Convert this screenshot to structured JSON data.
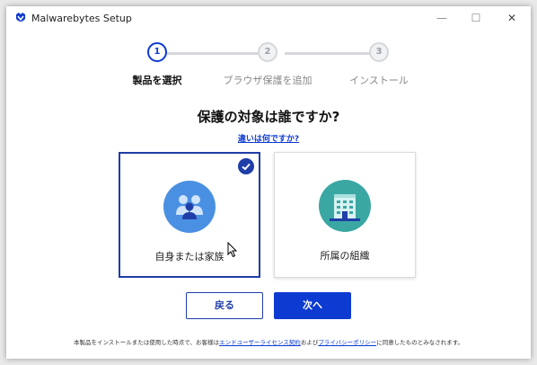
{
  "window": {
    "title": "Malwarebytes Setup",
    "minimize_glyph": "—",
    "maximize_glyph": "☐",
    "close_glyph": "✕"
  },
  "stepper": {
    "steps": [
      {
        "number": "1",
        "label": "製品を選択",
        "state": "active"
      },
      {
        "number": "2",
        "label": "ブラウザ保護を追加",
        "state": "inactive"
      },
      {
        "number": "3",
        "label": "インストール",
        "state": "inactive"
      }
    ]
  },
  "main": {
    "heading": "保護の対象は誰ですか?",
    "difference_link": "違いは何ですか?",
    "options": [
      {
        "label": "自身または家族",
        "icon": "family-icon",
        "selected": true
      },
      {
        "label": "所属の組織",
        "icon": "building-icon",
        "selected": false
      }
    ]
  },
  "buttons": {
    "back_label": "戻る",
    "next_label": "次へ"
  },
  "footer": {
    "text_before": "本製品をインストールまたは使用した時点で、お客様は",
    "eula_link": "エンドユーザーライセンス契約",
    "text_middle": "および",
    "privacy_link": "プライバシーポリシー",
    "text_after": "に同意したものとみなされます。"
  },
  "colors": {
    "accent": "#0d3bd1",
    "selected_border": "#1f3ea8",
    "family_icon_bg": "#4a90e2",
    "building_icon_bg": "#3aa7a3"
  }
}
